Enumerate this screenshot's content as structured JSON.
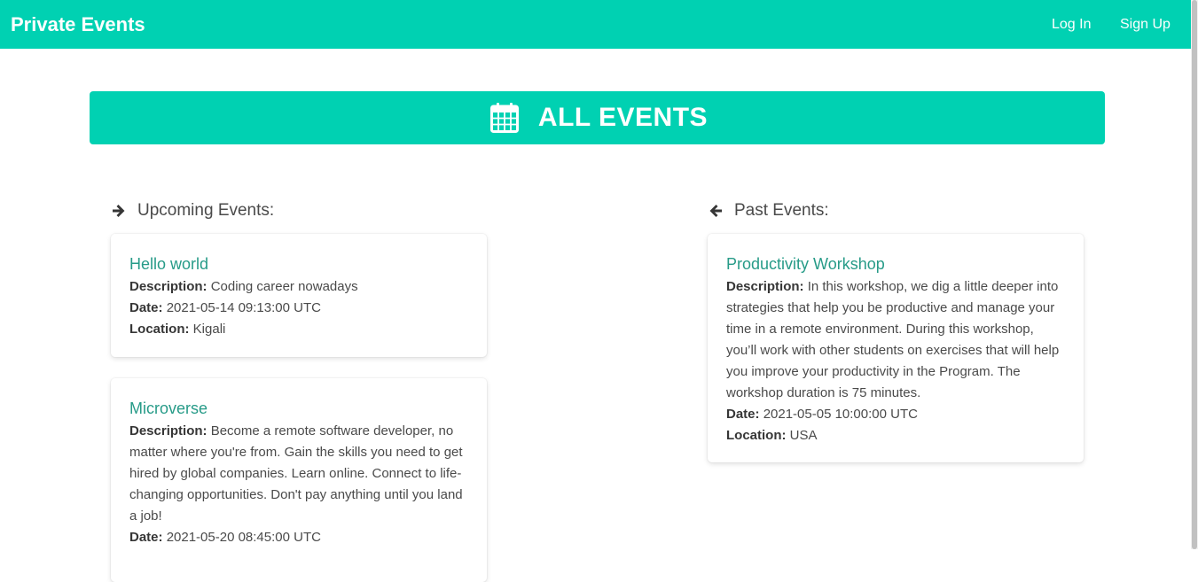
{
  "navbar": {
    "brand": "Private Events",
    "links": [
      "Log In",
      "Sign Up"
    ]
  },
  "hero": {
    "icon": "calendar-icon",
    "title": "ALL EVENTS"
  },
  "upcoming": {
    "heading": "Upcoming Events:",
    "icon": "arrow-right-icon",
    "events": [
      {
        "title": "Hello world",
        "description_label": "Description:",
        "description": "Coding career nowadays",
        "date_label": "Date:",
        "date": "2021-05-14 09:13:00 UTC",
        "location_label": "Location:",
        "location": "Kigali"
      },
      {
        "title": "Microverse",
        "description_label": "Description:",
        "description": "Become a remote software developer, no matter where you're from. Gain the skills you need to get hired by global companies. Learn online. Connect to life-changing opportunities. Don't pay anything until you land a job!",
        "date_label": "Date:",
        "date": "2021-05-20 08:45:00 UTC"
      }
    ]
  },
  "past": {
    "heading": "Past Events:",
    "icon": "arrow-left-icon",
    "events": [
      {
        "title": "Productivity Workshop",
        "description_label": "Description:",
        "description": "In this workshop, we dig a little deeper into strategies that help you be productive and manage your time in a remote environment. During this workshop, you’ll work with other students on exercises that will help you improve your productivity in the Program. The workshop duration is 75 minutes.",
        "date_label": "Date:",
        "date": "2021-05-05 10:00:00 UTC",
        "location_label": "Location:",
        "location": "USA"
      }
    ]
  },
  "colors": {
    "primary": "#00d1b2",
    "link": "#279b88",
    "text": "#4a4a4a"
  }
}
